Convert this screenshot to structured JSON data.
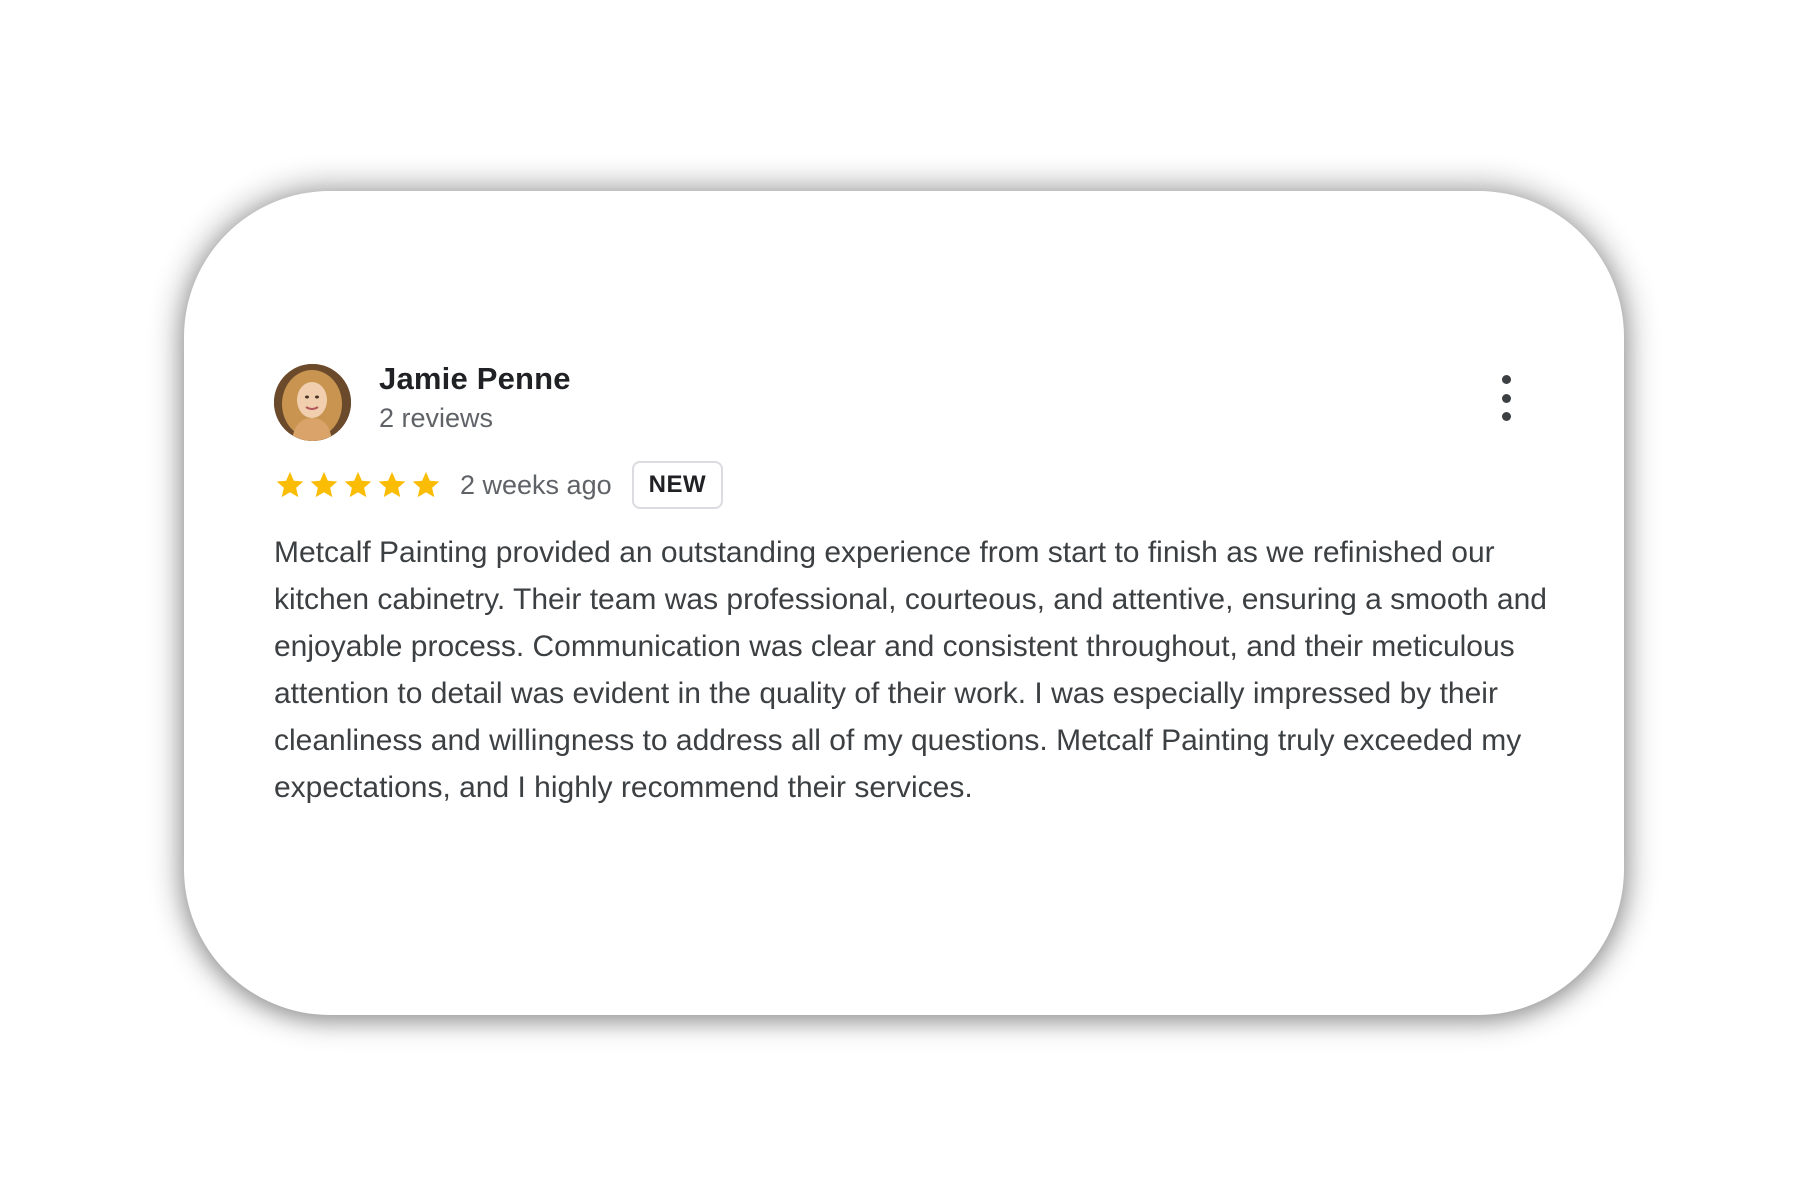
{
  "review": {
    "reviewer_name": "Jamie Penne",
    "review_count": "2 reviews",
    "rating": 5,
    "rating_max": 5,
    "date": "2 weeks ago",
    "badge": "NEW",
    "text": "Metcalf Painting provided an outstanding experience from start to finish as we refinished our kitchen cabinetry. Their team was professional, courteous, and attentive, ensuring a smooth and enjoyable process. Communication was clear and consistent throughout, and their meticulous attention to detail was evident in the quality of their work. I was especially impressed by their cleanliness and willingness to address all of my questions. Metcalf Painting truly exceeded my expectations, and I highly recommend their services."
  },
  "icons": {
    "star": "star-icon",
    "more": "more-vert-icon",
    "avatar": "avatar"
  },
  "colors": {
    "star": "#FBBC04",
    "name": "#202124",
    "secondary_text": "#5F6368",
    "body_text": "#3C4043",
    "badge_border": "#DADCE0",
    "background": "#FFFFFF"
  }
}
